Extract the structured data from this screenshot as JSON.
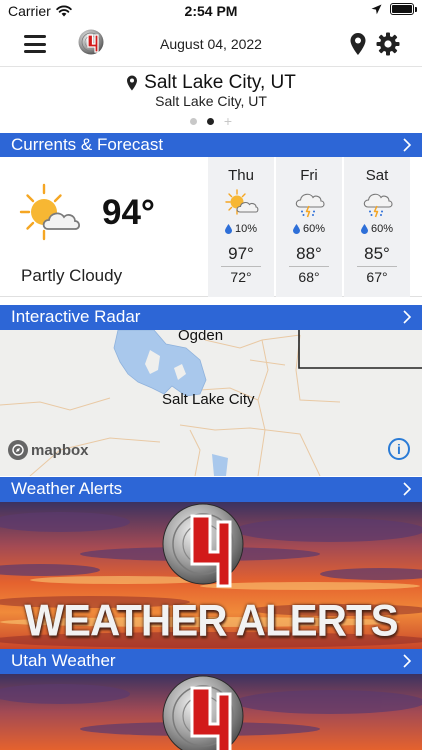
{
  "status_bar": {
    "carrier": "Carrier",
    "time": "2:54 PM",
    "battery_level": 1.0
  },
  "header": {
    "date": "August 04, 2022",
    "menu_icon": "hamburger-menu-icon",
    "logo_icon": "channel-4-logo-icon",
    "location_icon": "location-pin-icon",
    "settings_icon": "gear-icon"
  },
  "location": {
    "name": "Salt Lake City, UT",
    "subtitle": "Salt Lake City, UT",
    "pages": 2,
    "active_page": 1
  },
  "sections": {
    "forecast_title": "Currents & Forecast",
    "radar_title": "Interactive Radar",
    "alerts_title": "Weather Alerts",
    "utah_title": "Utah Weather"
  },
  "current": {
    "temp": "94°",
    "condition": "Partly Cloudy",
    "icon": "partly-cloudy-icon"
  },
  "forecast": [
    {
      "day": "Thu",
      "precip": "10%",
      "high": "97°",
      "low": "72°",
      "icon": "partly-cloudy-icon"
    },
    {
      "day": "Fri",
      "precip": "60%",
      "high": "88°",
      "low": "68°",
      "icon": "thunderstorm-icon"
    },
    {
      "day": "Sat",
      "precip": "60%",
      "high": "85°",
      "low": "67°",
      "icon": "thunderstorm-icon"
    }
  ],
  "radar": {
    "city_north": "Ogden",
    "city_main": "Salt Lake City",
    "attribution": "mapbox",
    "info_icon": "info-icon"
  },
  "banners": {
    "alerts_text": "WEATHER ALERTS"
  },
  "colors": {
    "section_bar": "#2d66d6",
    "forecast_column": "#f0f1f3",
    "lake_water": "#a9c8ec",
    "sun": "#f5a623"
  }
}
